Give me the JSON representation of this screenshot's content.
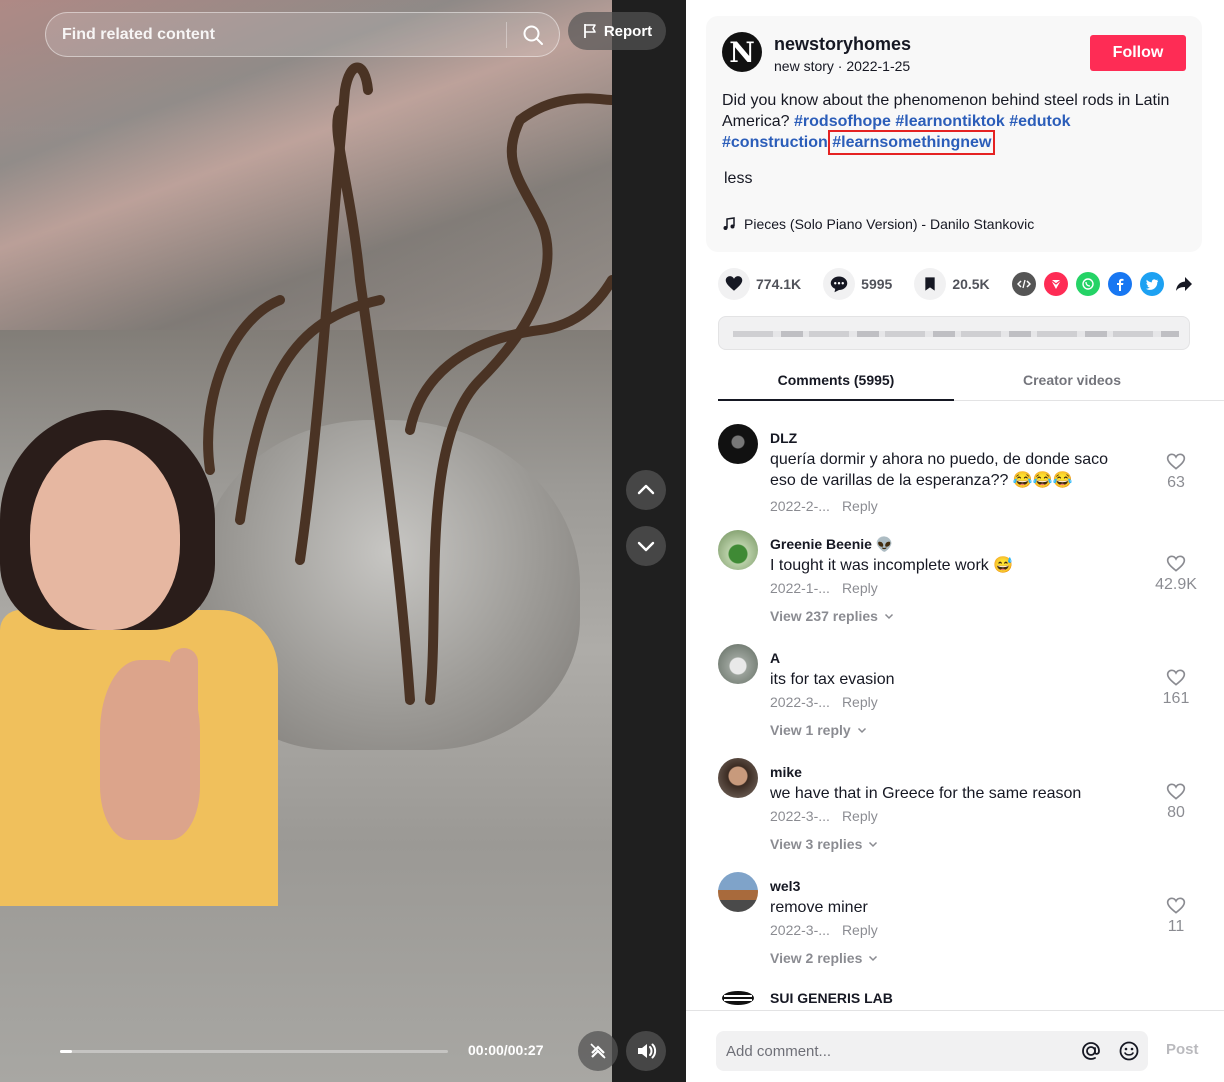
{
  "search": {
    "placeholder": "Find related content"
  },
  "report_label": "Report",
  "player": {
    "time": "00:00/00:27",
    "progress": 0.03
  },
  "author": {
    "avatar_letter": "N",
    "username": "newstoryhomes",
    "subline": "new story · 2022-1-25",
    "follow_label": "Follow"
  },
  "description": {
    "text": "Did you know about the phenomenon behind steel rods in Latin America?",
    "tags": [
      "#rodsofhope",
      "#learnontiktok",
      "#edutok",
      "#construction",
      "#learnsomethingnew"
    ],
    "less_label": "less",
    "music": "Pieces (Solo Piano Version) - Danilo Stankovic"
  },
  "stats": {
    "likes": "774.1K",
    "comments": "5995",
    "saves": "20.5K"
  },
  "share_icons": [
    "embed-icon",
    "send-icon",
    "whatsapp-icon",
    "facebook-icon",
    "twitter-icon",
    "share-arrow-icon"
  ],
  "colors": {
    "accent": "#fe2c55",
    "hashtag": "#2b5db9",
    "highlight": "#e52222",
    "whatsapp": "#25d366",
    "facebook": "#1877f2",
    "twitter": "#1da1f2",
    "send": "#fe2c55"
  },
  "tabs": {
    "comments": "Comments (5995)",
    "creator": "Creator videos"
  },
  "comments": [
    {
      "user": "DLZ",
      "text": "quería dormir y ahora no puedo, de donde saco eso de varillas de la esperanza?? 😂😂😂",
      "date": "2022-2-...",
      "reply": "Reply",
      "likes": "63",
      "more": ""
    },
    {
      "user": "Greenie Beenie 👽",
      "text": "I tought it was incomplete work 😅",
      "date": "2022-1-...",
      "reply": "Reply",
      "likes": "42.9K",
      "more": "View 237 replies"
    },
    {
      "user": "A",
      "text": "its for tax evasion",
      "date": "2022-3-...",
      "reply": "Reply",
      "likes": "161",
      "more": "View 1 reply"
    },
    {
      "user": "mike",
      "text": "we have that in Greece for the same reason",
      "date": "2022-3-...",
      "reply": "Reply",
      "likes": "80",
      "more": "View 3 replies"
    },
    {
      "user": "wel3",
      "text": "remove miner",
      "date": "2022-3-...",
      "reply": "Reply",
      "likes": "11",
      "more": "View 2 replies"
    },
    {
      "user": "SUI GENERIS LAB",
      "text": "",
      "date": "",
      "reply": "",
      "likes": "",
      "more": ""
    }
  ],
  "footer": {
    "placeholder": "Add comment...",
    "post_label": "Post"
  }
}
